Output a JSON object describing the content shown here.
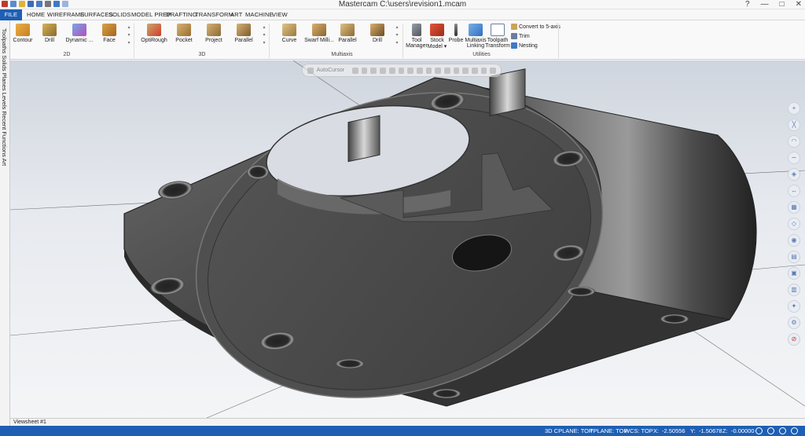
{
  "window": {
    "title": "Mastercam C:\\users\\revision1.mcam",
    "controls": {
      "minimize": "—",
      "maximize": "□",
      "close": "✕",
      "help": "?"
    }
  },
  "menu": {
    "tabs": [
      "FILE",
      "HOME",
      "WIREFRAME",
      "SURFACES",
      "SOLIDS",
      "MODEL PREP",
      "DRAFTING",
      "TRANSFORM",
      "ART",
      "MACHINE",
      "VIEW"
    ]
  },
  "ribbon": {
    "group_2d": {
      "label": "2D",
      "buttons": [
        "Contour",
        "Drill",
        "Dynamic ...",
        "Face"
      ]
    },
    "group_3d": {
      "label": "3D",
      "buttons": [
        "OptiRough",
        "Pocket",
        "Project",
        "Parallel"
      ]
    },
    "group_multiaxis": {
      "label": "Multiaxis",
      "buttons": [
        "Curve",
        "Swarf Milli...",
        "Parallel",
        "Drill"
      ]
    },
    "group_utilities": {
      "label": "Utilities",
      "tool_manager": {
        "line1": "Tool",
        "line2": "Manager"
      },
      "stock_model": {
        "line1": "Stock",
        "line2": "Model ▾"
      },
      "probe": "Probe",
      "multiaxis_linking": {
        "line1": "Multiaxis",
        "line2": "Linking"
      },
      "toolpath_transform": {
        "line1": "Toolpath",
        "line2": "Transform"
      },
      "small": [
        "Convert to 5-axis",
        "Trim",
        "Nesting"
      ]
    }
  },
  "left_tabs": "Toolpaths Solids Planes Levels Recent Functions Art",
  "autocursor": {
    "label": "AutoCursor"
  },
  "viewsheet": {
    "tab": "Viewsheet #1"
  },
  "status": {
    "cplane": "3D  CPLANE: TOP",
    "tplane": "TPLANE: TOP",
    "wcs": "WCS: TOP",
    "x_label": "X:",
    "x_value": "-2.50556",
    "y_label": "Y:",
    "y_value": "-1.50678",
    "z_label": "Z:",
    "z_value": "-0.00000"
  },
  "colors": {
    "accent": "#1e5fb4",
    "model": "#4a4a4a"
  }
}
